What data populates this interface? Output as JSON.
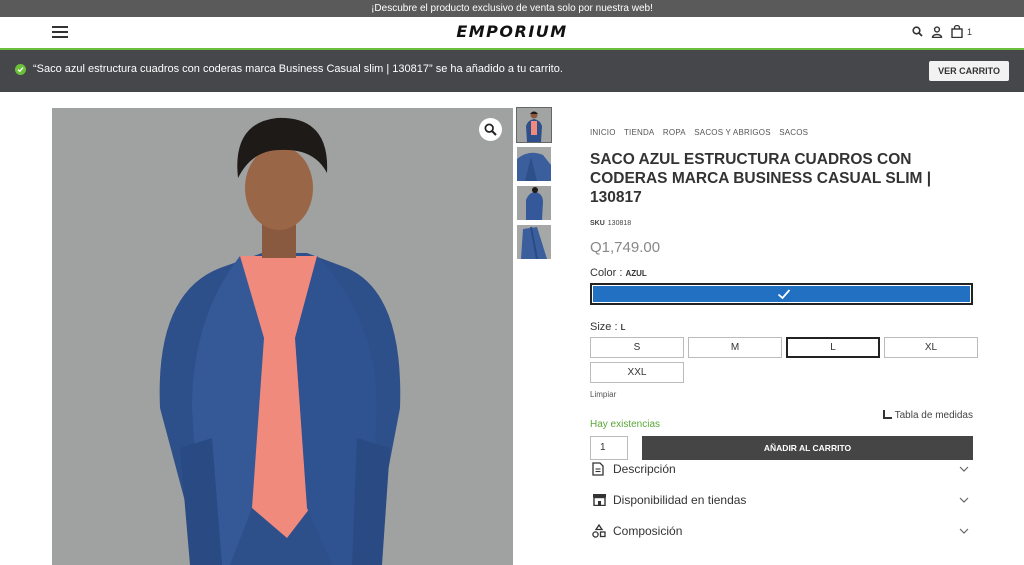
{
  "promo": {
    "text": "¡Descubre el producto exclusivo de venta solo por nuestra web!"
  },
  "header": {
    "brand": "EMPORIUM",
    "cart_count": "1"
  },
  "notice": {
    "message": "“Saco azul estructura cuadros con coderas marca Business Casual slim | 130817” se ha añadido a tu carrito.",
    "button": "VER CARRITO"
  },
  "breadcrumb": [
    "INICIO",
    "TIENDA",
    "ROPA",
    "SACOS Y ABRIGOS",
    "SACOS"
  ],
  "product": {
    "title": "SACO AZUL ESTRUCTURA CUADROS CON CODERAS MARCA BUSINESS CASUAL SLIM | 130817",
    "sku_label": "SKU",
    "sku": "130818",
    "price": "Q1,749.00"
  },
  "color": {
    "label": "Color :",
    "value": "AZUL",
    "swatch": "#2170c2"
  },
  "size": {
    "label": "Size :",
    "value": "L",
    "options": [
      "S",
      "M",
      "L",
      "XL",
      "XXL"
    ],
    "selected_index": 2
  },
  "clear_label": "Limpiar",
  "stock": "Hay existencias",
  "size_chart": "Tabla de medidas",
  "quantity": "1",
  "add_to_cart": "AÑADIR AL CARRITO",
  "accordion": [
    {
      "label": "Descripción",
      "icon": "document-icon"
    },
    {
      "label": "Disponibilidad en tiendas",
      "icon": "store-icon"
    },
    {
      "label": "Composición",
      "icon": "shapes-icon"
    }
  ],
  "colors": {
    "accent_green": "#6bbf3a",
    "notice_bg": "#45474a",
    "stock_green": "#5aa73a"
  }
}
